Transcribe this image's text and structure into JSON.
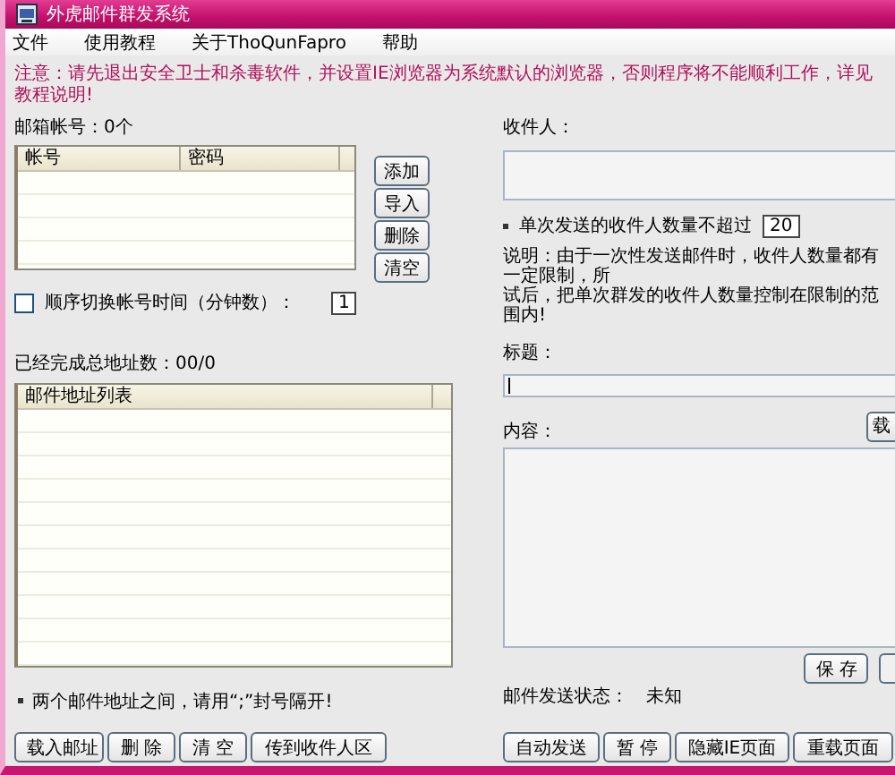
{
  "window": {
    "title": "外虎邮件群发系统"
  },
  "menu": [
    {
      "label": "文件"
    },
    {
      "label": "使用教程"
    },
    {
      "label": "关于ThoQunFapro"
    },
    {
      "label": "帮助"
    }
  ],
  "notice": "注意：请先退出安全卫士和杀毒软件，并设置IE浏览器为系统默认的浏览器，否则程序将不能顺利工作，详见教程说明!",
  "accounts": {
    "label": "邮箱帐号：0个",
    "columns": [
      "帐号",
      "密码"
    ],
    "buttons": [
      "添加",
      "导入",
      "删除",
      "清空"
    ]
  },
  "rotate": {
    "label": "顺序切换帐号时间（分钟数）：",
    "checked": false,
    "value": "1"
  },
  "progress_label": "已经完成总地址数：00/0",
  "addresses": {
    "columns": [
      "邮件地址列表"
    ]
  },
  "address_hint": "两个邮件地址之间，请用“;”封号隔开!",
  "left_buttons": [
    "载入邮址",
    "删 除",
    "清 空",
    "传到收件人区"
  ],
  "recipients_label": "收件人：",
  "limit": {
    "label": "单次发送的收件人数量不超过",
    "value": "20"
  },
  "explanation": [
    "说明：由于一次性发送邮件时，收件人数量都有一定限制，所",
    "试后，把单次群发的收件人数量控制在限制的范围内!"
  ],
  "subject_label": "标题：",
  "content_label": "内容：",
  "content_button": "载",
  "save_button": "保 存",
  "status": {
    "label": "邮件发送状态：",
    "value": "未知"
  },
  "right_buttons": [
    "自动发送",
    "暂 停",
    "隐藏IE页面",
    "重载页面"
  ]
}
